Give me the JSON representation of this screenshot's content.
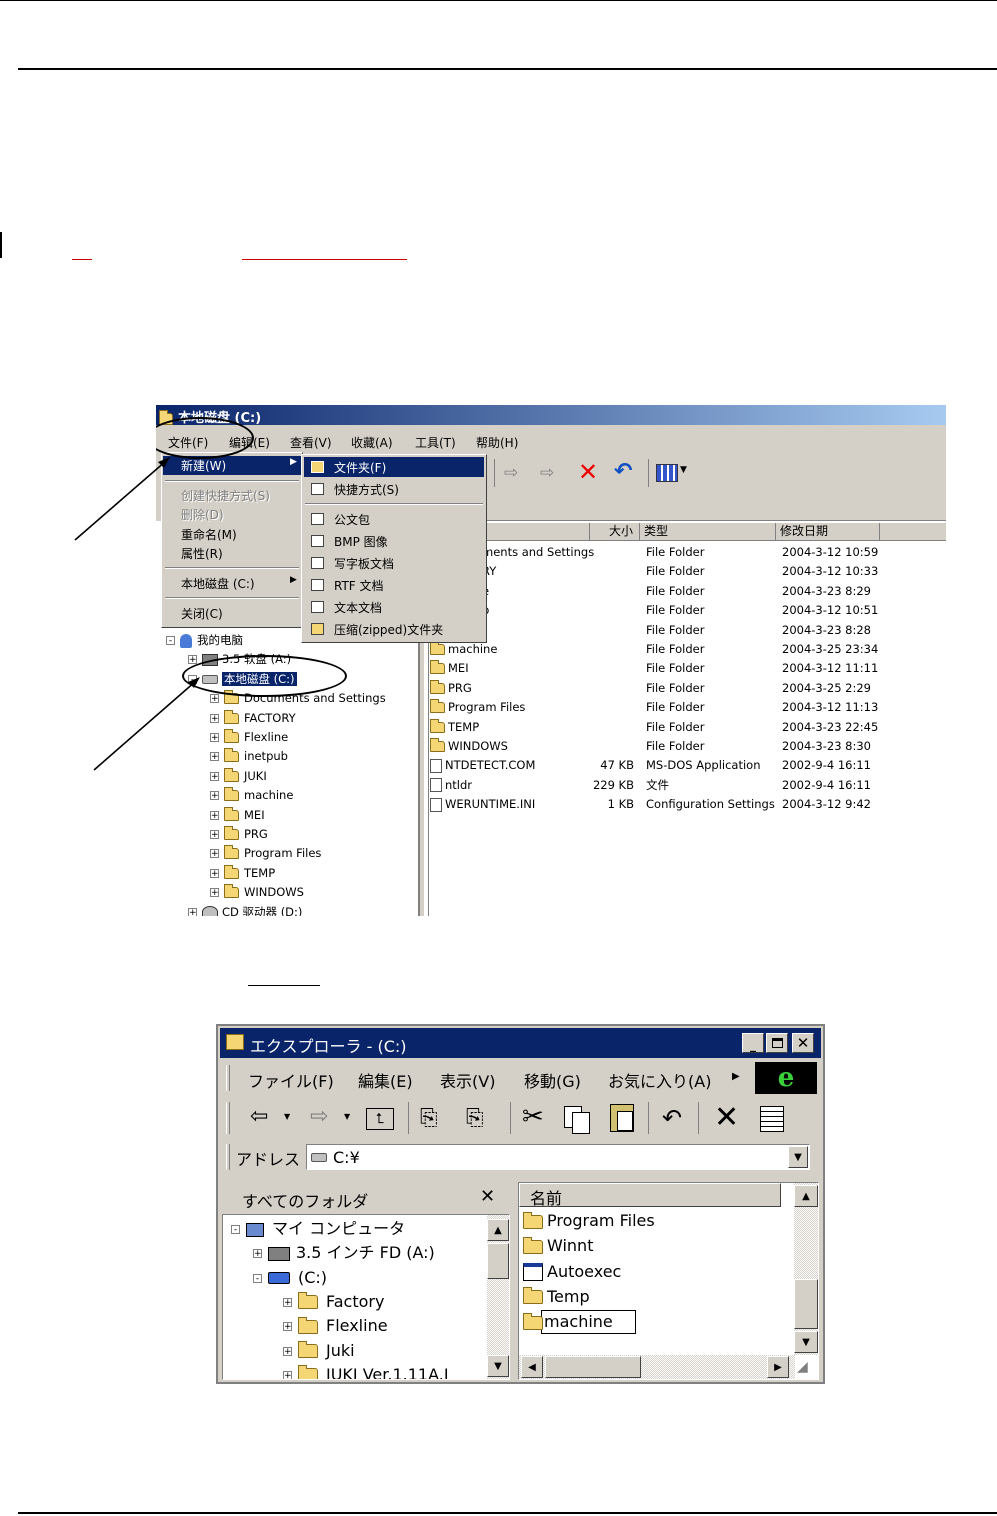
{
  "win1": {
    "title": "本地磁盘 (C:)",
    "menubar": [
      "文件(F)",
      "编辑(E)",
      "查看(V)",
      "收藏(A)",
      "工具(T)",
      "帮助(H)"
    ],
    "file_menu": [
      {
        "label": "新建(W)",
        "highlight": true,
        "arrow": true
      },
      {
        "label": "创建快捷方式(S)",
        "disabled": true
      },
      {
        "label": "删除(D)",
        "disabled": true
      },
      {
        "label": "重命名(M)"
      },
      {
        "label": "属性(R)"
      },
      {
        "label": "本地磁盘 (C:)",
        "arrow": true
      },
      {
        "label": "关闭(C)"
      }
    ],
    "new_submenu": [
      {
        "label": "文件夹(F)",
        "icon": "folder-icon",
        "highlight": true
      },
      {
        "label": "快捷方式(S)",
        "icon": "shortcut-icon"
      },
      {
        "label": "公文包",
        "icon": "briefcase-icon"
      },
      {
        "label": "BMP 图像",
        "icon": "bmp-icon"
      },
      {
        "label": "写字板文档",
        "icon": "wordpad-icon"
      },
      {
        "label": "RTF 文档",
        "icon": "rtf-icon"
      },
      {
        "label": "文本文档",
        "icon": "text-doc-icon"
      },
      {
        "label": "压缩(zipped)文件夹",
        "icon": "zip-folder-icon"
      }
    ],
    "tree": {
      "my_computer": "我的电脑",
      "floppy": "3.5 软盘 (A:)",
      "local_disk": "本地磁盘 (C:)",
      "folders": [
        "Documents and Settings",
        "FACTORY",
        "Flexline",
        "inetpub",
        "JUKI",
        "machine",
        "MEI",
        "PRG",
        "Program Files",
        "TEMP",
        "WINDOWS"
      ],
      "cd": "CD 驱动器 (D:)"
    },
    "list_headers": [
      "大小",
      "类型",
      "修改日期"
    ],
    "list_rows": [
      {
        "name": "ments and Settings",
        "size": "",
        "type": "File Folder",
        "date": "2004-3-12 10:59"
      },
      {
        "name": "RY",
        "size": "",
        "type": "File Folder",
        "date": "2004-3-12 10:33"
      },
      {
        "name": "e",
        "size": "",
        "type": "File Folder",
        "date": "2004-3-23 8:29"
      },
      {
        "name": "b",
        "size": "",
        "type": "File Folder",
        "date": "2004-3-12 10:51"
      },
      {
        "name": "",
        "size": "",
        "type": "File Folder",
        "date": "2004-3-23 8:28"
      },
      {
        "name": "machine",
        "size": "",
        "type": "File Folder",
        "date": "2004-3-25 23:34",
        "icon": "folder"
      },
      {
        "name": "MEI",
        "size": "",
        "type": "File Folder",
        "date": "2004-3-12 11:11",
        "icon": "folder"
      },
      {
        "name": "PRG",
        "size": "",
        "type": "File Folder",
        "date": "2004-3-25 2:29",
        "icon": "folder"
      },
      {
        "name": "Program Files",
        "size": "",
        "type": "File Folder",
        "date": "2004-3-12 11:13",
        "icon": "folder"
      },
      {
        "name": "TEMP",
        "size": "",
        "type": "File Folder",
        "date": "2004-3-23 22:45",
        "icon": "folder"
      },
      {
        "name": "WINDOWS",
        "size": "",
        "type": "File Folder",
        "date": "2004-3-23 8:30",
        "icon": "folder"
      },
      {
        "name": "NTDETECT.COM",
        "size": "47 KB",
        "type": "MS-DOS Application",
        "date": "2002-9-4 16:11",
        "icon": "file"
      },
      {
        "name": "ntldr",
        "size": "229 KB",
        "type": "文件",
        "date": "2002-9-4 16:11",
        "icon": "file"
      },
      {
        "name": "WERUNTIME.INI",
        "size": "1 KB",
        "type": "Configuration Settings",
        "date": "2004-3-12 9:42",
        "icon": "file"
      }
    ]
  },
  "win2": {
    "title": "エクスプローラ - (C:)",
    "menubar": [
      "ファイル(F)",
      "編集(E)",
      "表示(V)",
      "移動(G)",
      "お気に入り(A)"
    ],
    "address_label": "アドレス",
    "address_value": "C:¥",
    "folders_pane_title": "すべてのフォルダ",
    "tree": {
      "my_computer": "マイ コンピュータ",
      "floppy": "3.5 インチ FD (A:)",
      "drive": "(C:)",
      "folders": [
        "Factory",
        "Flexline",
        "Juki",
        "JUKI Ver.1.11A.I"
      ]
    },
    "list_header": "名前",
    "list_items": [
      {
        "name": "Program Files",
        "icon": "folder"
      },
      {
        "name": "Winnt",
        "icon": "folder"
      },
      {
        "name": "Autoexec",
        "icon": "file"
      },
      {
        "name": "Temp",
        "icon": "folder"
      },
      {
        "name": "machine",
        "icon": "folder",
        "editing": true
      }
    ]
  }
}
